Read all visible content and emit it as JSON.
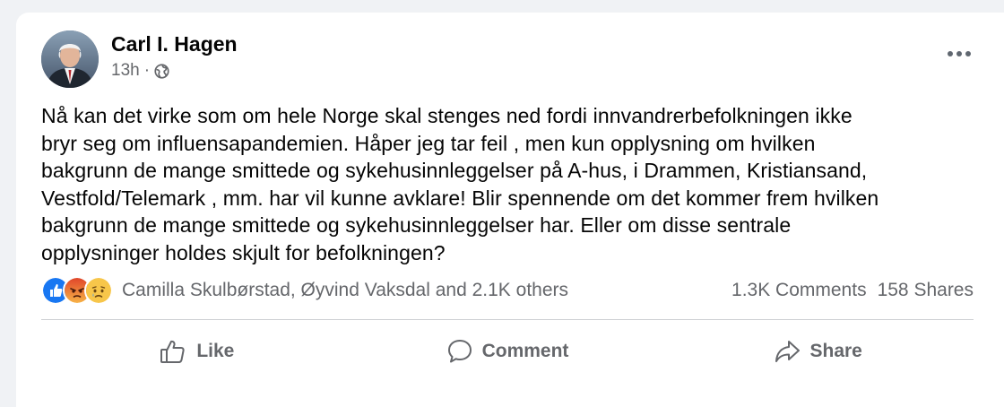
{
  "post": {
    "author": "Carl I. Hagen",
    "timestamp": "13h",
    "separator": "·",
    "privacy_icon": "globe-icon",
    "text_lines": [
      "Nå kan det virke som om hele Norge skal stenges ned fordi innvandrerbefolkningen ikke",
      "bryr seg om influensapandemien. Håper jeg tar feil , men kun opplysning om hvilken",
      "bakgrunn de mange smittede og sykehusinnleggelser på A-hus, i Drammen, Kristiansand,",
      "Vestfold/Telemark , mm. har vil kunne avklare! Blir spennende om det kommer frem hvilken",
      "bakgrunn de mange smittede og sykehusinnleggelser har. Eller om disse sentrale",
      "opplysninger holdes skjult for befolkningen?"
    ]
  },
  "reactions": {
    "icons": [
      "like-reaction-icon",
      "angry-reaction-icon",
      "sad-reaction-icon"
    ],
    "summary": "Camilla Skulbørstad, Øyvind Vaksdal and 2.1K others",
    "comments": "1.3K Comments",
    "shares": "158 Shares"
  },
  "actions": {
    "like": "Like",
    "comment": "Comment",
    "share": "Share"
  },
  "colors": {
    "like_blue": "#1877f2",
    "angry_orange": "#f0643c",
    "sad_yellow": "#f7c64a",
    "secondary_text": "#65676b"
  }
}
